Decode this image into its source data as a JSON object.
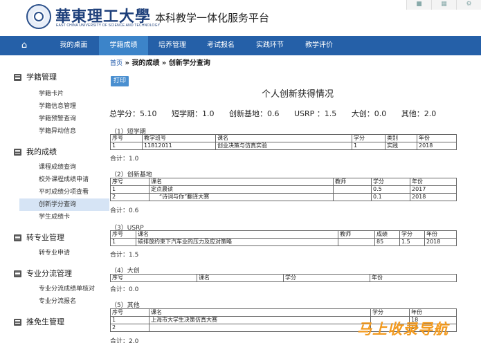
{
  "header": {
    "logo_text": "華東理工大學",
    "logo_en": "EAST CHINA UNIVERSITY OF SCIENCE AND TECHNOLOGY",
    "platform": "本科教学一体化服务平台"
  },
  "nav": {
    "home_icon": "home-icon",
    "items": [
      "我的桌面",
      "学籍成绩",
      "培养管理",
      "考试报名",
      "实践环节",
      "教学评价"
    ],
    "active": "学籍成绩"
  },
  "sidebar": {
    "groups": [
      {
        "title": "学籍管理",
        "items": [
          "学籍卡片",
          "学籍信息管理",
          "学籍预警查询",
          "学籍异动信息"
        ]
      },
      {
        "title": "我的成绩",
        "items": [
          "课程成绩查询",
          "校外课程成绩申请",
          "平时成绩分项查看",
          "创新学分查询",
          "学生成绩卡"
        ]
      },
      {
        "title": "转专业管理",
        "items": [
          "转专业申请"
        ]
      },
      {
        "title": "专业分流管理",
        "items": [
          "专业分流成绩单核对",
          "专业分流报名"
        ]
      },
      {
        "title": "推免生管理",
        "items": []
      }
    ],
    "selected": "创新学分查询"
  },
  "breadcrumb": {
    "home": "首页",
    "sep1": " » ",
    "level1": "我的成绩",
    "sep2": " » ",
    "level2": "创新学分查询"
  },
  "print_label": "打印",
  "report_title": "个人创新获得情况",
  "summary": {
    "total": "总学分：5.10",
    "short_term": "短学期：1.0",
    "base": "创新基地：0.6",
    "usrp": "USRP ：1.5",
    "dachuang": "大创：0.0",
    "other": "其他：2.0"
  },
  "sections": {
    "s1": {
      "label": "（1）短学期",
      "headers": [
        "序号",
        "教学班号",
        "课名",
        "学分",
        "类别",
        "年份"
      ],
      "rows": [
        [
          "1",
          "11812011",
          "创业决策与仿真实验",
          "1",
          "实践",
          "2018"
        ]
      ],
      "total": "合计：1.0"
    },
    "s2": {
      "label": "（2）创新基地",
      "headers": [
        "序号",
        "课名",
        "教师",
        "学分",
        "年份"
      ],
      "rows": [
        [
          "1",
          "定点晨读",
          "",
          "0.5",
          "2017"
        ],
        [
          "2",
          "“诗词与你”翻译大赛",
          "",
          "0.1",
          "2018"
        ]
      ],
      "total": "合计：0.6"
    },
    "s3": {
      "label": "（3）USRP",
      "headers": [
        "序号",
        "课名",
        "教师",
        "成绩",
        "学分",
        "年份"
      ],
      "rows": [
        [
          "1",
          "碳排放约束下汽车业的压力及应对策略",
          "",
          "85",
          "1.5",
          "2018"
        ]
      ],
      "total": "合计：1.5"
    },
    "s4": {
      "label": "（4）大创",
      "headers": [
        "序号",
        "课名",
        "学分",
        "年份"
      ],
      "rows": [],
      "total": "合计：0.0"
    },
    "s5": {
      "label": "（5）其他",
      "headers": [
        "序号",
        "课名",
        "学分",
        "年份"
      ],
      "rows": [
        [
          "1",
          "上海市大学生决策仿真大赛",
          "",
          "18"
        ],
        [
          "2",
          "",
          "",
          "18"
        ]
      ],
      "total": "合计：2.0"
    }
  },
  "watermark": "马上收录导航"
}
